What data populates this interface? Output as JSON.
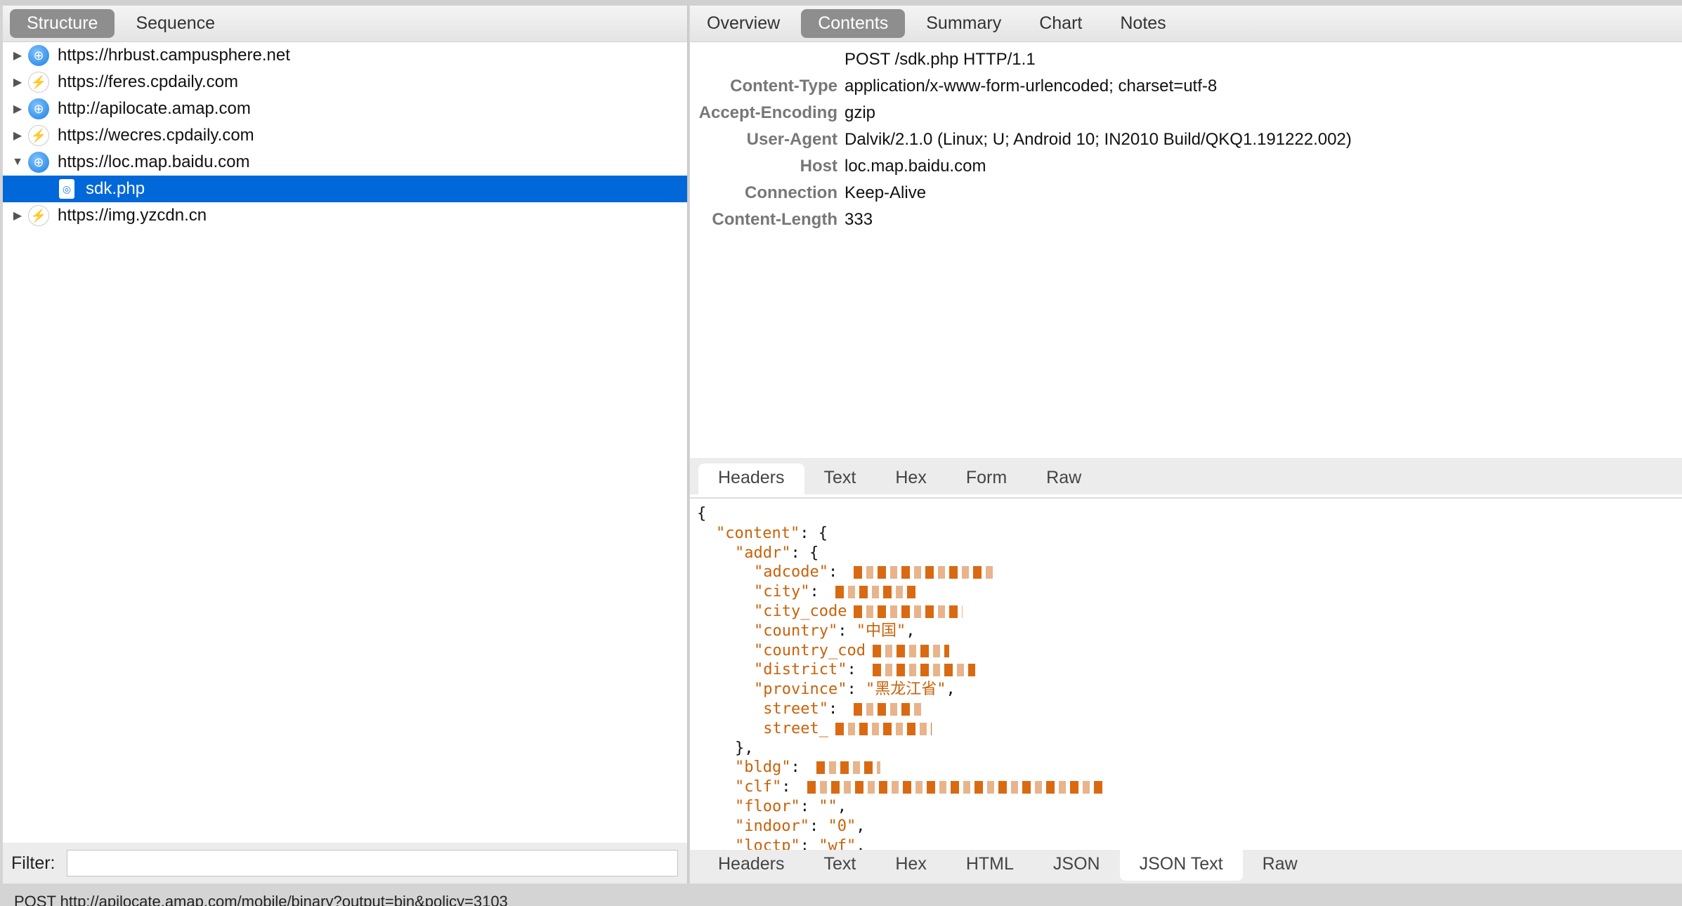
{
  "left": {
    "tabs": [
      {
        "label": "Structure",
        "active": true
      },
      {
        "label": "Sequence",
        "active": false
      }
    ],
    "tree": [
      {
        "label": "https://hrbust.campusphere.net",
        "icon": "globe",
        "expanded": false
      },
      {
        "label": "https://feres.cpdaily.com",
        "icon": "bolt",
        "expanded": false
      },
      {
        "label": "http://apilocate.amap.com",
        "icon": "globe",
        "expanded": false
      },
      {
        "label": "https://wecres.cpdaily.com",
        "icon": "bolt",
        "expanded": false
      },
      {
        "label": "https://loc.map.baidu.com",
        "icon": "globe",
        "expanded": true
      },
      {
        "label": "sdk.php",
        "icon": "file",
        "child": true,
        "selected": true
      },
      {
        "label": "https://img.yzcdn.cn",
        "icon": "bolt",
        "expanded": false
      }
    ],
    "filter_label": "Filter:",
    "filter_value": ""
  },
  "right": {
    "tabs": [
      {
        "label": "Overview"
      },
      {
        "label": "Contents",
        "active": true
      },
      {
        "label": "Summary"
      },
      {
        "label": "Chart"
      },
      {
        "label": "Notes"
      }
    ],
    "request_line": "POST /sdk.php HTTP/1.1",
    "headers": [
      {
        "k": "Content-Type",
        "v": "application/x-www-form-urlencoded; charset=utf-8"
      },
      {
        "k": "Accept-Encoding",
        "v": "gzip"
      },
      {
        "k": "User-Agent",
        "v": "Dalvik/2.1.0 (Linux; U; Android 10; IN2010 Build/QKQ1.191222.002)"
      },
      {
        "k": "Host",
        "v": "loc.map.baidu.com"
      },
      {
        "k": "Connection",
        "v": "Keep-Alive"
      },
      {
        "k": "Content-Length",
        "v": "333"
      }
    ],
    "request_tabs": [
      {
        "label": "Headers",
        "active": true
      },
      {
        "label": "Text"
      },
      {
        "label": "Hex"
      },
      {
        "label": "Form"
      },
      {
        "label": "Raw"
      }
    ],
    "response_tabs": [
      {
        "label": "Headers"
      },
      {
        "label": "Text"
      },
      {
        "label": "Hex"
      },
      {
        "label": "HTML"
      },
      {
        "label": "JSON"
      },
      {
        "label": "JSON Text",
        "active": true
      },
      {
        "label": "Raw"
      }
    ],
    "json_lines": [
      {
        "i": 0,
        "t": "{"
      },
      {
        "i": 1,
        "k": "\"content\"",
        "t": ": {"
      },
      {
        "i": 2,
        "k": "\"addr\"",
        "t": ": {"
      },
      {
        "i": 3,
        "k": "\"adcode\"",
        "t": ": ",
        "redacted": true
      },
      {
        "i": 3,
        "k": "\"city\"",
        "t": ": ",
        "redacted": true
      },
      {
        "i": 3,
        "k": "\"city_code",
        "t": "",
        "redacted": true
      },
      {
        "i": 3,
        "k": "\"country\"",
        "t": ": ",
        "s": "\"中国\"",
        "e": ","
      },
      {
        "i": 3,
        "k": "\"country_cod",
        "t": "",
        "redacted": true
      },
      {
        "i": 3,
        "k": "\"district\"",
        "t": ": ",
        "redacted": true
      },
      {
        "i": 3,
        "k": "\"province\"",
        "t": ": ",
        "s": "\"黑龙江省\"",
        "e": ","
      },
      {
        "i": 3,
        "k": " street\"",
        "t": ": ",
        "redacted": true
      },
      {
        "i": 3,
        "k": " street_",
        "t": "",
        "redacted": true
      },
      {
        "i": 2,
        "t": "},"
      },
      {
        "i": 2,
        "k": "\"bldg\"",
        "t": ": ",
        "redacted": true
      },
      {
        "i": 2,
        "k": "\"clf\"",
        "t": ": ",
        "redacted": true,
        "wide": true
      },
      {
        "i": 2,
        "k": "\"floor\"",
        "t": ": ",
        "s": "\"\"",
        "e": ","
      },
      {
        "i": 2,
        "k": "\"indoor\"",
        "t": ": ",
        "s": "\"0\"",
        "e": ","
      },
      {
        "i": 2,
        "k": "\"loctp\"",
        "t": ": ",
        "s": "\"wf\"",
        "e": ","
      }
    ]
  },
  "status": "POST http://apilocate.amap.com/mobile/binary?output=bin&policy=3103"
}
